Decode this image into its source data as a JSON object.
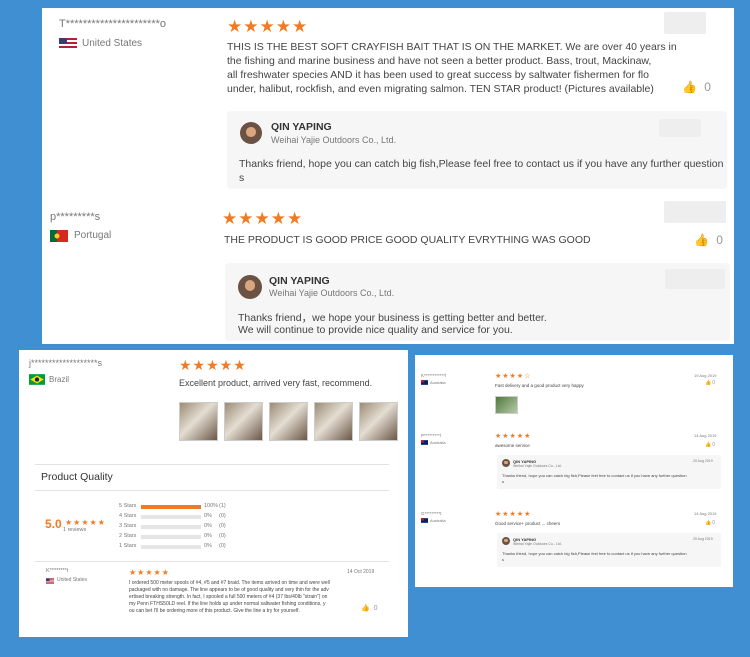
{
  "panel1": {
    "review1": {
      "user": "T**********************o",
      "country": "United States",
      "stars": "★★★★★",
      "text_lines": [
        "THIS IS THE BEST SOFT CRAYFISH BAIT THAT IS ON THE MARKET. We are over 40 years in",
        "the fishing and marine business and have not seen a better product. Bass, trout, Mackinaw,",
        "all freshwater species AND it has been used to great success by saltwater fishermen for flo",
        "under, halibut, rockfish, and even migrating salmon. TEN STAR product! (Pictures available)"
      ],
      "likes": "0",
      "reply": {
        "name": "QIN YAPING",
        "company": "Weihai Yajie Outdoors Co., Ltd.",
        "text_lines": [
          "Thanks friend, hope you can catch big fish,Please feel free to contact us if you have any further question",
          "s"
        ]
      }
    },
    "review2": {
      "user": "p*********s",
      "country": "Portugal",
      "stars": "★★★★★",
      "text": "THE PRODUCT IS GOOD PRICE GOOD QUALITY EVRYTHING WAS GOOD",
      "likes": "0",
      "reply": {
        "name": "QIN YAPING",
        "company": "Weihai Yajie Outdoors Co., Ltd.",
        "text_lines": [
          "Thanks friend，we hope your business is getting better and better.",
          "We will continue to provide nice quality and service for you."
        ]
      }
    }
  },
  "panel2": {
    "review": {
      "user": "j*******************s",
      "country": "Brazil",
      "stars": "★★★★★",
      "text": "Excellent product, arrived very fast, recommend."
    },
    "quality": {
      "title": "Product Quality",
      "score": "5.0",
      "stars": "★★★★★",
      "reviews": "1 reviews",
      "rows": [
        {
          "label": "5 Stars",
          "pct": "100%",
          "count": "(1)",
          "fill": 1.0
        },
        {
          "label": "4 Stars",
          "pct": "0%",
          "count": "(0)",
          "fill": 0
        },
        {
          "label": "3 Stars",
          "pct": "0%",
          "count": "(0)",
          "fill": 0
        },
        {
          "label": "2 Stars",
          "pct": "0%",
          "count": "(0)",
          "fill": 0
        },
        {
          "label": "1 Stars",
          "pct": "0%",
          "count": "(0)",
          "fill": 0
        }
      ]
    },
    "review_b": {
      "user": "K********t",
      "country": "United States",
      "stars": "★★★★★",
      "date": "14 Oct 2019",
      "text_lines": [
        "I ordered 500 meter spools of #4, #5 and #7 braid. The items arrived on time and were well",
        "packaged with no damage. The line appears to be of good quality and very thin for the adv",
        "ertised breaking strength. In fact, I spooled a full 500 meters of #4 (37 lbs/40lb \"strain\") on",
        "my Penn FTHS50LD reel. If the line holds up under normal saltwater fishing conditions, y",
        "ou can bet I'll be ordering more of this product. Give the line a try for yourself."
      ],
      "likes": "0"
    }
  },
  "panel3": {
    "reviews": [
      {
        "user": "K************l",
        "country": "Australia",
        "stars": "★★★★☆",
        "date": "19 Aug 2019",
        "text": "Fast delivery and a good product very happy",
        "likes": "0"
      },
      {
        "user": "P*********l",
        "country": "Australia",
        "stars": "★★★★★",
        "date": "14 Aug 2019",
        "text": "awesome service",
        "likes": "0",
        "reply": {
          "name": "QIN YAPING",
          "company": "Weihai Yajie Outdoors Co., Ltd.",
          "date": "20 Aug 2019",
          "text_lines": [
            "Thanks friend, hope you can catch big fish,Please feel free to contact us if you have any further question",
            "s"
          ]
        }
      },
      {
        "user": "G*********t",
        "country": "Australia",
        "stars": "★★★★★",
        "date": "14 Aug 2019",
        "text": "Good service+ product ... cheers",
        "likes": "0",
        "reply": {
          "name": "QIN YAPING",
          "company": "Weihai Yajie Outdoors Co., Ltd.",
          "date": "20 Aug 2019",
          "text_lines": [
            "Thanks friend, hope you can catch big fish,Please feel free to contact us if you have any further question",
            "s"
          ]
        }
      }
    ]
  },
  "icons": {
    "thumb": "thumbs-up-icon"
  },
  "colors": {
    "background": "#3f8fd2",
    "star": "#f07b22"
  }
}
